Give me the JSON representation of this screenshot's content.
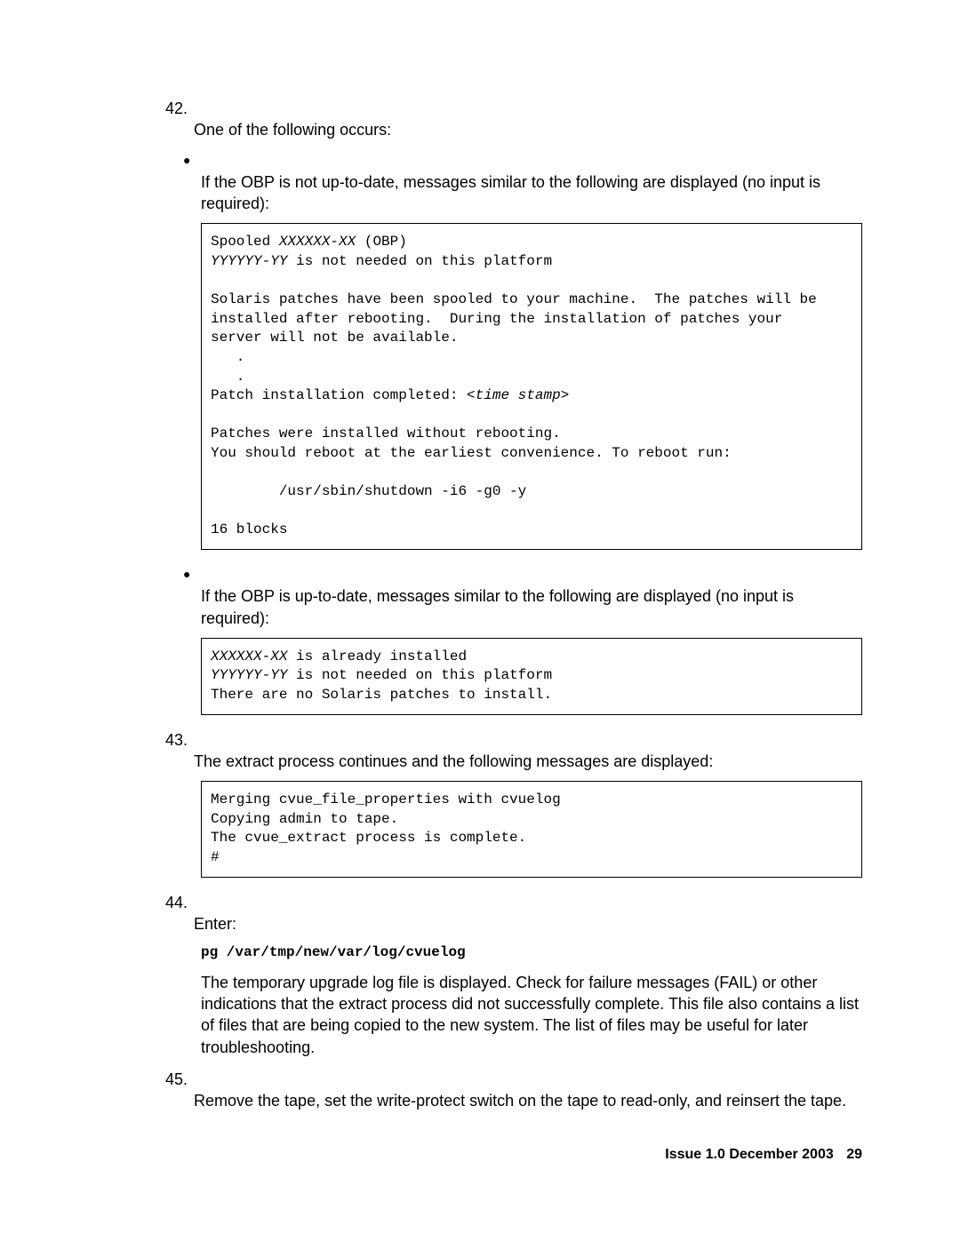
{
  "steps": {
    "s42": {
      "num": "42.",
      "text": "One of the following occurs:",
      "bullet1": "If the OBP is not up-to-date, messages similar to the following are displayed (no input is required):",
      "bullet2": "If the OBP is up-to-date, messages similar to the following are displayed (no input is required):"
    },
    "s43": {
      "num": "43.",
      "text": "The extract process continues and the following messages are displayed:"
    },
    "s44": {
      "num": "44.",
      "text": "Enter:",
      "cmd": "pg /var/tmp/new/var/log/cvuelog",
      "para": "The temporary upgrade log file is displayed. Check for failure messages (FAIL) or other indications that the extract process did not successfully complete. This file also contains a list of files that are being copied to the new system. The list of files may be useful for later troubleshooting."
    },
    "s45": {
      "num": "45.",
      "text": "Remove the tape, set the write-protect switch on the tape to read-only, and reinsert the tape."
    }
  },
  "code1": {
    "l1a": "Spooled ",
    "l1b": "XXXXXX-XX",
    "l1c": " (OBP)",
    "l2a": "YYYYYY-YY",
    "l2b": " is not needed on this platform",
    "blank1": "",
    "l3": "Solaris patches have been spooled to your machine.  The patches will be",
    "l4": "installed after rebooting.  During the installation of patches your",
    "l5": "server will not be available.",
    "l6": "   .",
    "l7": "   .",
    "l8a": "Patch installation completed: ",
    "l8b": "<time stamp>",
    "blank2": "",
    "l9": "Patches were installed without rebooting.",
    "l10": "You should reboot at the earliest convenience. To reboot run:",
    "blank3": "",
    "l11": "        /usr/sbin/shutdown -i6 -g0 -y",
    "blank4": "",
    "l12": "16 blocks"
  },
  "code2": {
    "l1a": "XXXXXX-XX",
    "l1b": " is already installed",
    "l2a": "YYYYYY-YY",
    "l2b": " is not needed on this platform",
    "l3": "There are no Solaris patches to install."
  },
  "code3": {
    "l1": "Merging cvue_file_properties with cvuelog",
    "l2": "Copying admin to tape.",
    "l3": "The cvue_extract process is complete.",
    "l4": "#"
  },
  "footer": {
    "issue": "Issue 1.0   December 2003",
    "page": "29"
  }
}
